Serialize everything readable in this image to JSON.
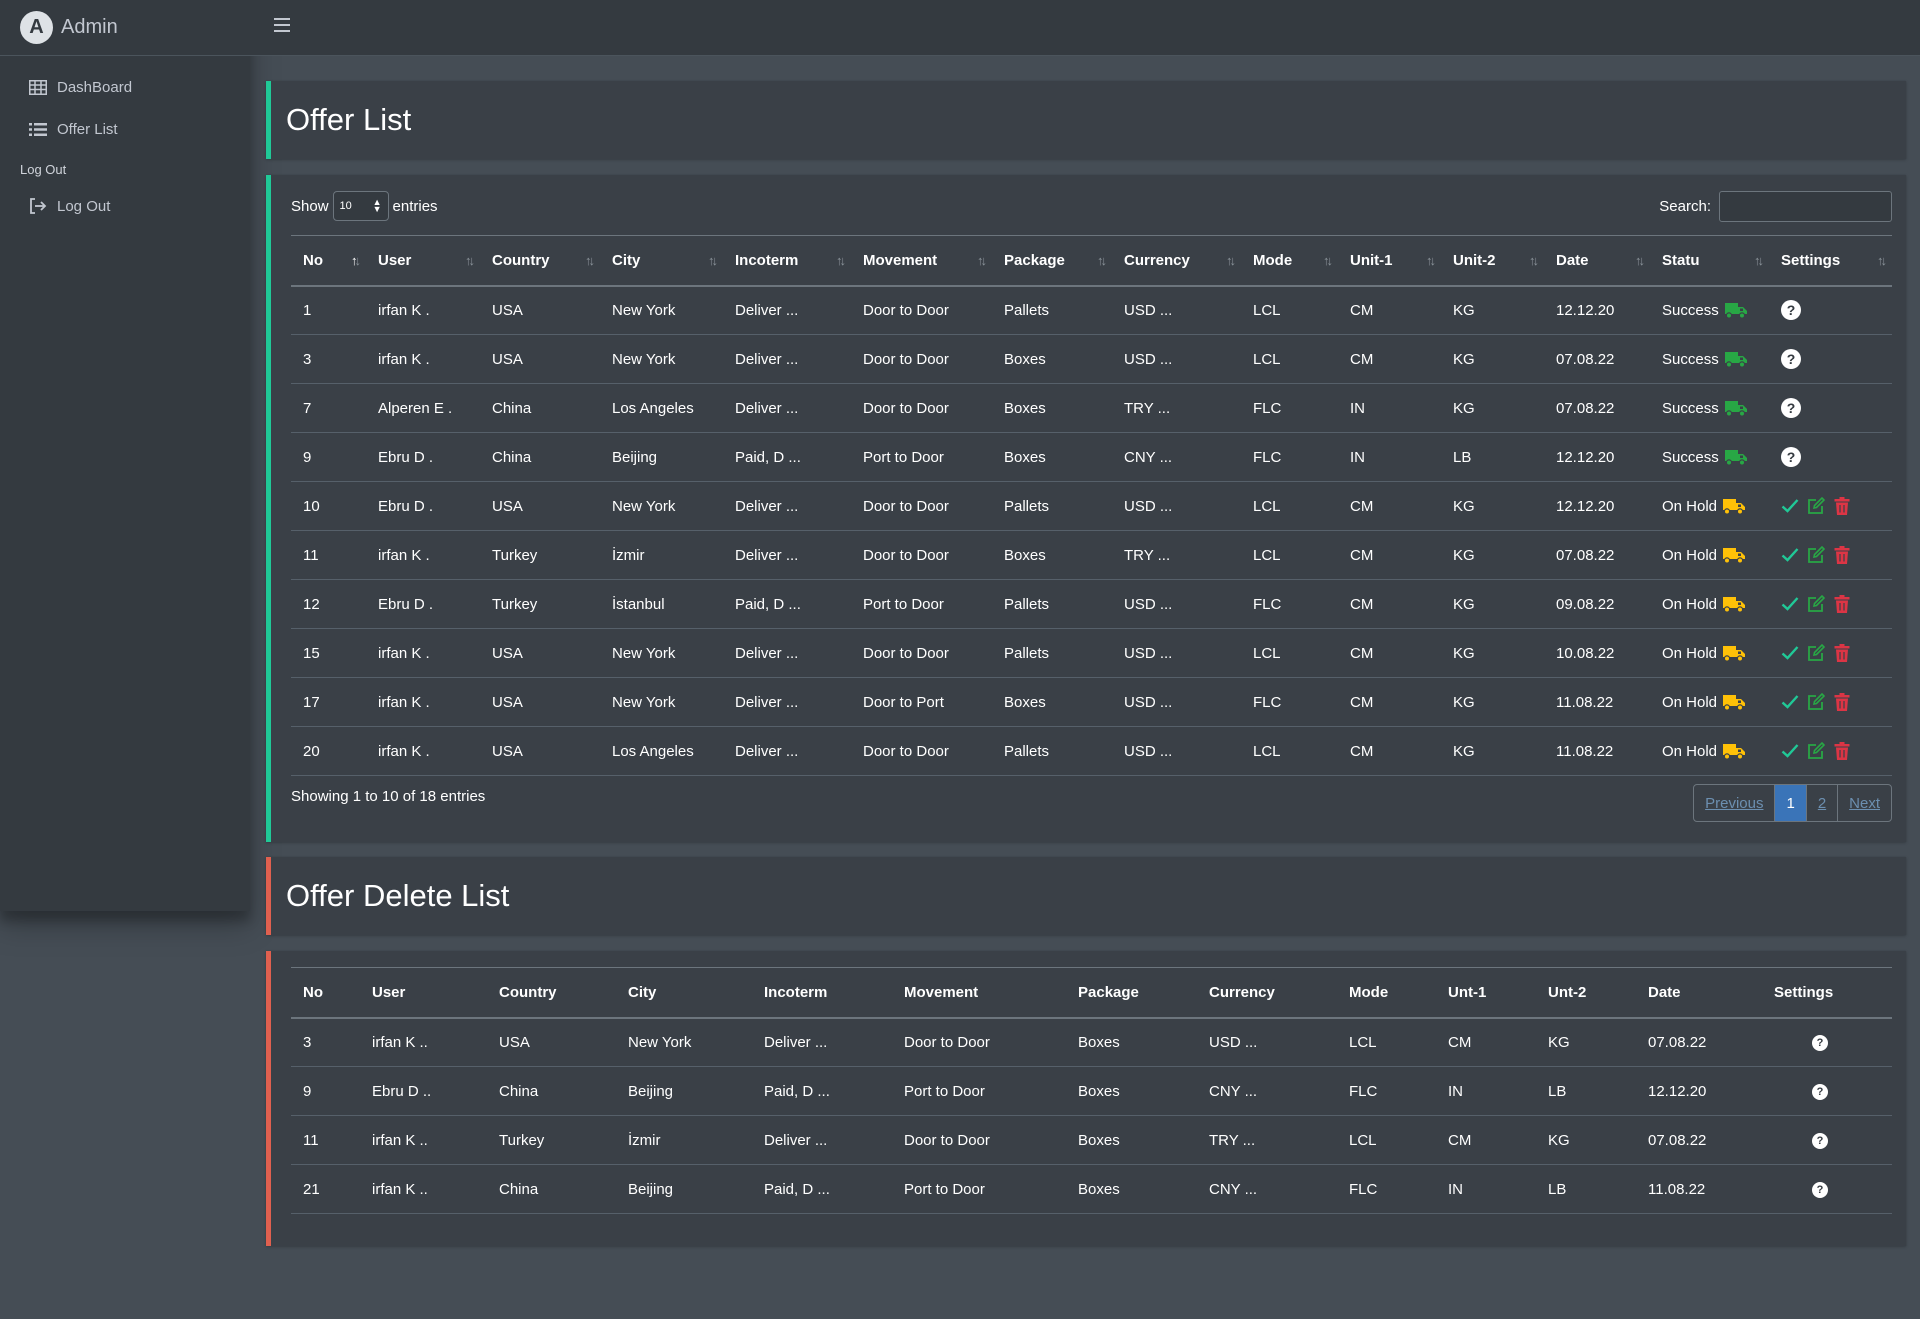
{
  "brand": {
    "name": "Admin"
  },
  "sidebar": {
    "items": [
      {
        "label": "DashBoard",
        "icon": "table-icon"
      },
      {
        "label": "Offer List",
        "icon": "list-icon"
      }
    ],
    "header": "Log Out",
    "logout": {
      "label": "Log Out",
      "icon": "sign-out-icon"
    }
  },
  "offer_list": {
    "title": "Offer List",
    "show_label": "Show",
    "entries_label": "entries",
    "page_size": "10",
    "search_label": "Search:",
    "search_value": "",
    "columns": [
      "No",
      "User",
      "Country",
      "City",
      "Incoterm",
      "Movement",
      "Package",
      "Currency",
      "Mode",
      "Unit-1",
      "Unit-2",
      "Date",
      "Statu",
      "Settings"
    ],
    "rows": [
      {
        "no": "1",
        "user": "irfan K .",
        "country": "USA",
        "city": "New York",
        "incoterm": "Deliver ...",
        "movement": "Door to Door",
        "package": "Pallets",
        "currency": "USD ...",
        "mode": "LCL",
        "unit1": "CM",
        "unit2": "KG",
        "date": "12.12.20",
        "status": "Success",
        "status_type": "success"
      },
      {
        "no": "3",
        "user": "irfan K .",
        "country": "USA",
        "city": "New York",
        "incoterm": "Deliver ...",
        "movement": "Door to Door",
        "package": "Boxes",
        "currency": "USD ...",
        "mode": "LCL",
        "unit1": "CM",
        "unit2": "KG",
        "date": "07.08.22",
        "status": "Success",
        "status_type": "success"
      },
      {
        "no": "7",
        "user": "Alperen E .",
        "country": "China",
        "city": "Los Angeles",
        "incoterm": "Deliver ...",
        "movement": "Door to Door",
        "package": "Boxes",
        "currency": "TRY ...",
        "mode": "FLC",
        "unit1": "IN",
        "unit2": "KG",
        "date": "07.08.22",
        "status": "Success",
        "status_type": "success"
      },
      {
        "no": "9",
        "user": "Ebru D .",
        "country": "China",
        "city": "Beijing",
        "incoterm": "Paid, D ...",
        "movement": "Port to Door",
        "package": "Boxes",
        "currency": "CNY ...",
        "mode": "FLC",
        "unit1": "IN",
        "unit2": "LB",
        "date": "12.12.20",
        "status": "Success",
        "status_type": "success"
      },
      {
        "no": "10",
        "user": "Ebru D .",
        "country": "USA",
        "city": "New York",
        "incoterm": "Deliver ...",
        "movement": "Door to Door",
        "package": "Pallets",
        "currency": "USD ...",
        "mode": "LCL",
        "unit1": "CM",
        "unit2": "KG",
        "date": "12.12.20",
        "status": "On Hold",
        "status_type": "hold"
      },
      {
        "no": "11",
        "user": "irfan K .",
        "country": "Turkey",
        "city": "İzmir",
        "incoterm": "Deliver ...",
        "movement": "Door to Door",
        "package": "Boxes",
        "currency": "TRY ...",
        "mode": "LCL",
        "unit1": "CM",
        "unit2": "KG",
        "date": "07.08.22",
        "status": "On Hold",
        "status_type": "hold"
      },
      {
        "no": "12",
        "user": "Ebru D .",
        "country": "Turkey",
        "city": "İstanbul",
        "incoterm": "Paid, D ...",
        "movement": "Port to Door",
        "package": "Pallets",
        "currency": "USD ...",
        "mode": "FLC",
        "unit1": "CM",
        "unit2": "KG",
        "date": "09.08.22",
        "status": "On Hold",
        "status_type": "hold"
      },
      {
        "no": "15",
        "user": "irfan K .",
        "country": "USA",
        "city": "New York",
        "incoterm": "Deliver ...",
        "movement": "Door to Door",
        "package": "Pallets",
        "currency": "USD ...",
        "mode": "LCL",
        "unit1": "CM",
        "unit2": "KG",
        "date": "10.08.22",
        "status": "On Hold",
        "status_type": "hold"
      },
      {
        "no": "17",
        "user": "irfan K .",
        "country": "USA",
        "city": "New York",
        "incoterm": "Deliver ...",
        "movement": "Door to Port",
        "package": "Boxes",
        "currency": "USD ...",
        "mode": "FLC",
        "unit1": "CM",
        "unit2": "KG",
        "date": "11.08.22",
        "status": "On Hold",
        "status_type": "hold"
      },
      {
        "no": "20",
        "user": "irfan K .",
        "country": "USA",
        "city": "Los Angeles",
        "incoterm": "Deliver ...",
        "movement": "Door to Door",
        "package": "Pallets",
        "currency": "USD ...",
        "mode": "LCL",
        "unit1": "CM",
        "unit2": "KG",
        "date": "11.08.22",
        "status": "On Hold",
        "status_type": "hold"
      }
    ],
    "info": "Showing 1 to 10 of 18 entries",
    "pagination": {
      "previous": "Previous",
      "pages": [
        "1",
        "2"
      ],
      "current": "1",
      "next": "Next"
    }
  },
  "offer_delete_list": {
    "title": "Offer Delete List",
    "columns": [
      "No",
      "User",
      "Country",
      "City",
      "Incoterm",
      "Movement",
      "Package",
      "Currency",
      "Mode",
      "Unt-1",
      "Unt-2",
      "Date",
      "Settings"
    ],
    "rows": [
      {
        "no": "3",
        "user": "irfan K ..",
        "country": "USA",
        "city": "New York",
        "incoterm": "Deliver ...",
        "movement": "Door to Door",
        "package": "Boxes",
        "currency": "USD ...",
        "mode": "LCL",
        "unit1": "CM",
        "unit2": "KG",
        "date": "07.08.22"
      },
      {
        "no": "9",
        "user": "Ebru D ..",
        "country": "China",
        "city": "Beijing",
        "incoterm": "Paid, D ...",
        "movement": "Port to Door",
        "package": "Boxes",
        "currency": "CNY ...",
        "mode": "FLC",
        "unit1": "IN",
        "unit2": "LB",
        "date": "12.12.20"
      },
      {
        "no": "11",
        "user": "irfan K ..",
        "country": "Turkey",
        "city": "İzmir",
        "incoterm": "Deliver ...",
        "movement": "Door to Door",
        "package": "Boxes",
        "currency": "TRY ...",
        "mode": "LCL",
        "unit1": "CM",
        "unit2": "KG",
        "date": "07.08.22"
      },
      {
        "no": "21",
        "user": "irfan K ..",
        "country": "China",
        "city": "Beijing",
        "incoterm": "Paid, D ...",
        "movement": "Port to Door",
        "package": "Boxes",
        "currency": "CNY ...",
        "mode": "FLC",
        "unit1": "IN",
        "unit2": "LB",
        "date": "11.08.22"
      }
    ]
  },
  "colors": {
    "success_truck": "#28a745",
    "hold_truck": "#ffc107",
    "approve": "#20c997",
    "edit": "#28a745",
    "delete": "#dc3545",
    "accent_green": "#20c997",
    "accent_red": "#e0604f"
  }
}
